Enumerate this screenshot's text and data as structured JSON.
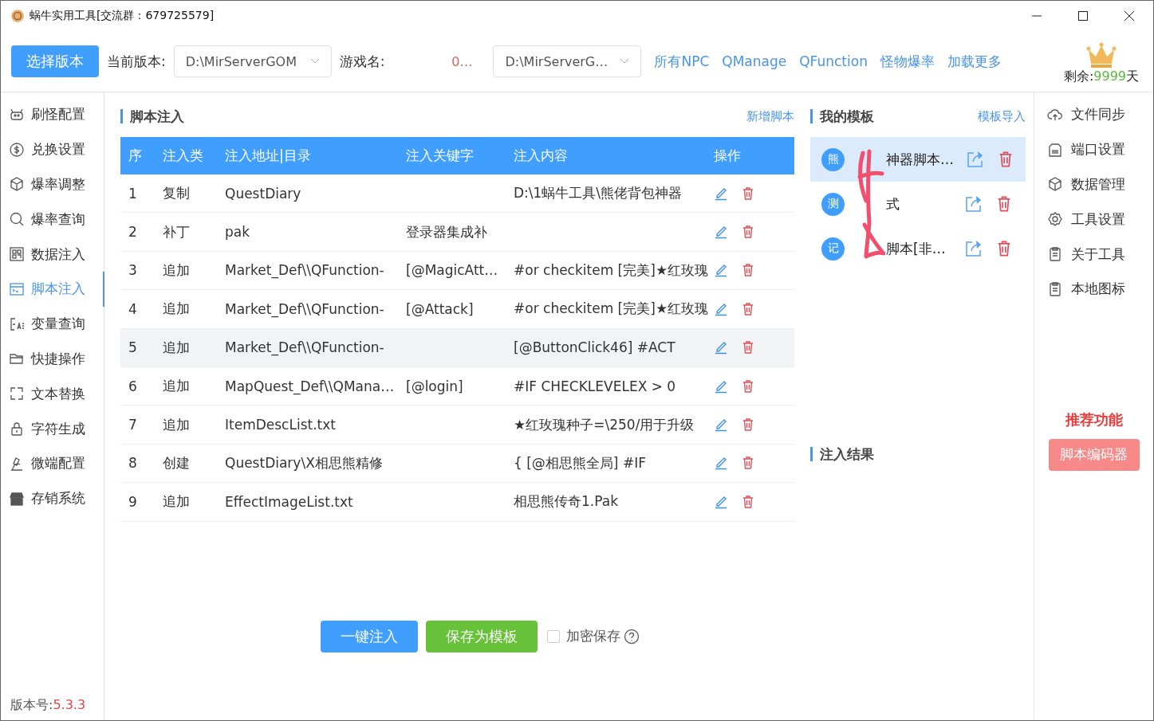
{
  "window": {
    "title": "蜗牛实用工具[交流群：679725579]"
  },
  "toolbar": {
    "select_button": "选择版本",
    "version_label": "当前版本:",
    "version_value": "D:\\MirServerGOM",
    "game_label": "游戏名:",
    "game_name": "0…",
    "path_value": "D:\\MirServerG…",
    "links": [
      "所有NPC",
      "QManage",
      "QFunction",
      "怪物爆率",
      "加载更多"
    ],
    "remaining": {
      "label": "剩余:",
      "value": "9999",
      "unit": "天"
    }
  },
  "sidebar": {
    "items": [
      {
        "label": "刷怪配置",
        "selected": false
      },
      {
        "label": "兑换设置",
        "selected": false
      },
      {
        "label": "爆率调整",
        "selected": false
      },
      {
        "label": "爆率查询",
        "selected": false
      },
      {
        "label": "数据注入",
        "selected": false
      },
      {
        "label": "脚本注入",
        "selected": true
      },
      {
        "label": "变量查询",
        "selected": false
      },
      {
        "label": "快捷操作",
        "selected": false
      },
      {
        "label": "文本替换",
        "selected": false
      },
      {
        "label": "字符生成",
        "selected": false
      },
      {
        "label": "微端配置",
        "selected": false
      },
      {
        "label": "存销系统",
        "selected": false
      }
    ],
    "version_label": "版本号:",
    "version": "5.3.3"
  },
  "script_panel": {
    "title": "脚本注入",
    "add_link": "新增脚本",
    "table": {
      "columns": [
        "序",
        "注入类",
        "注入地址|目录",
        "注入关键字",
        "注入内容",
        "操作"
      ],
      "rows": [
        {
          "cells": [
            "1",
            "复制",
            "QuestDiary",
            "",
            "D:\\1蜗牛工具\\熊佬背包神器"
          ],
          "selected": false
        },
        {
          "cells": [
            "2",
            "补丁",
            "pak",
            "登录器集成补",
            ""
          ],
          "selected": false
        },
        {
          "cells": [
            "3",
            "追加",
            "Market_Def\\\\QFunction-",
            "[@MagicAtt…",
            "#or checkitem [完美]★红玫瑰"
          ],
          "selected": false
        },
        {
          "cells": [
            "4",
            "追加",
            "Market_Def\\\\QFunction-",
            "[@Attack]",
            "#or checkitem [完美]★红玫瑰"
          ],
          "selected": false
        },
        {
          "cells": [
            "5",
            "追加",
            "Market_Def\\\\QFunction-",
            "",
            "[@ButtonClick46] #ACT"
          ],
          "selected": true
        },
        {
          "cells": [
            "6",
            "追加",
            "MapQuest_Def\\\\QMana…",
            "[@login]",
            "#IF CHECKLEVELEX > 0"
          ],
          "selected": false
        },
        {
          "cells": [
            "7",
            "追加",
            "ItemDescList.txt",
            "",
            "★红玫瑰种子=\\250/用于升级"
          ],
          "selected": false
        },
        {
          "cells": [
            "8",
            "创建",
            "QuestDiary\\X相思熊精修",
            "",
            "{ [@相思熊全局] #IF"
          ],
          "selected": false
        },
        {
          "cells": [
            "9",
            "追加",
            "EffectImageList.txt",
            "",
            "相思熊传奇1.Pak"
          ],
          "selected": false
        }
      ]
    },
    "inject_button": "一键注入",
    "save_button": "保存为模板",
    "encrypt": {
      "label": "加密保存",
      "checked": false
    }
  },
  "templates": {
    "title": "我的模板",
    "import_link": "模板导入",
    "items": [
      {
        "avatar": "熊",
        "name": "神器脚本…",
        "selected": true
      },
      {
        "avatar": "测",
        "name": "式",
        "selected": false
      },
      {
        "avatar": "记",
        "name": "脚本[非…",
        "selected": false
      }
    ],
    "result_title": "注入结果"
  },
  "right_menu": {
    "items": [
      "文件同步",
      "端口设置",
      "数据管理",
      "工具设置",
      "关于工具",
      "本地图标"
    ],
    "recommend_title": "推荐功能",
    "recommend_button": "脚本编码器"
  }
}
